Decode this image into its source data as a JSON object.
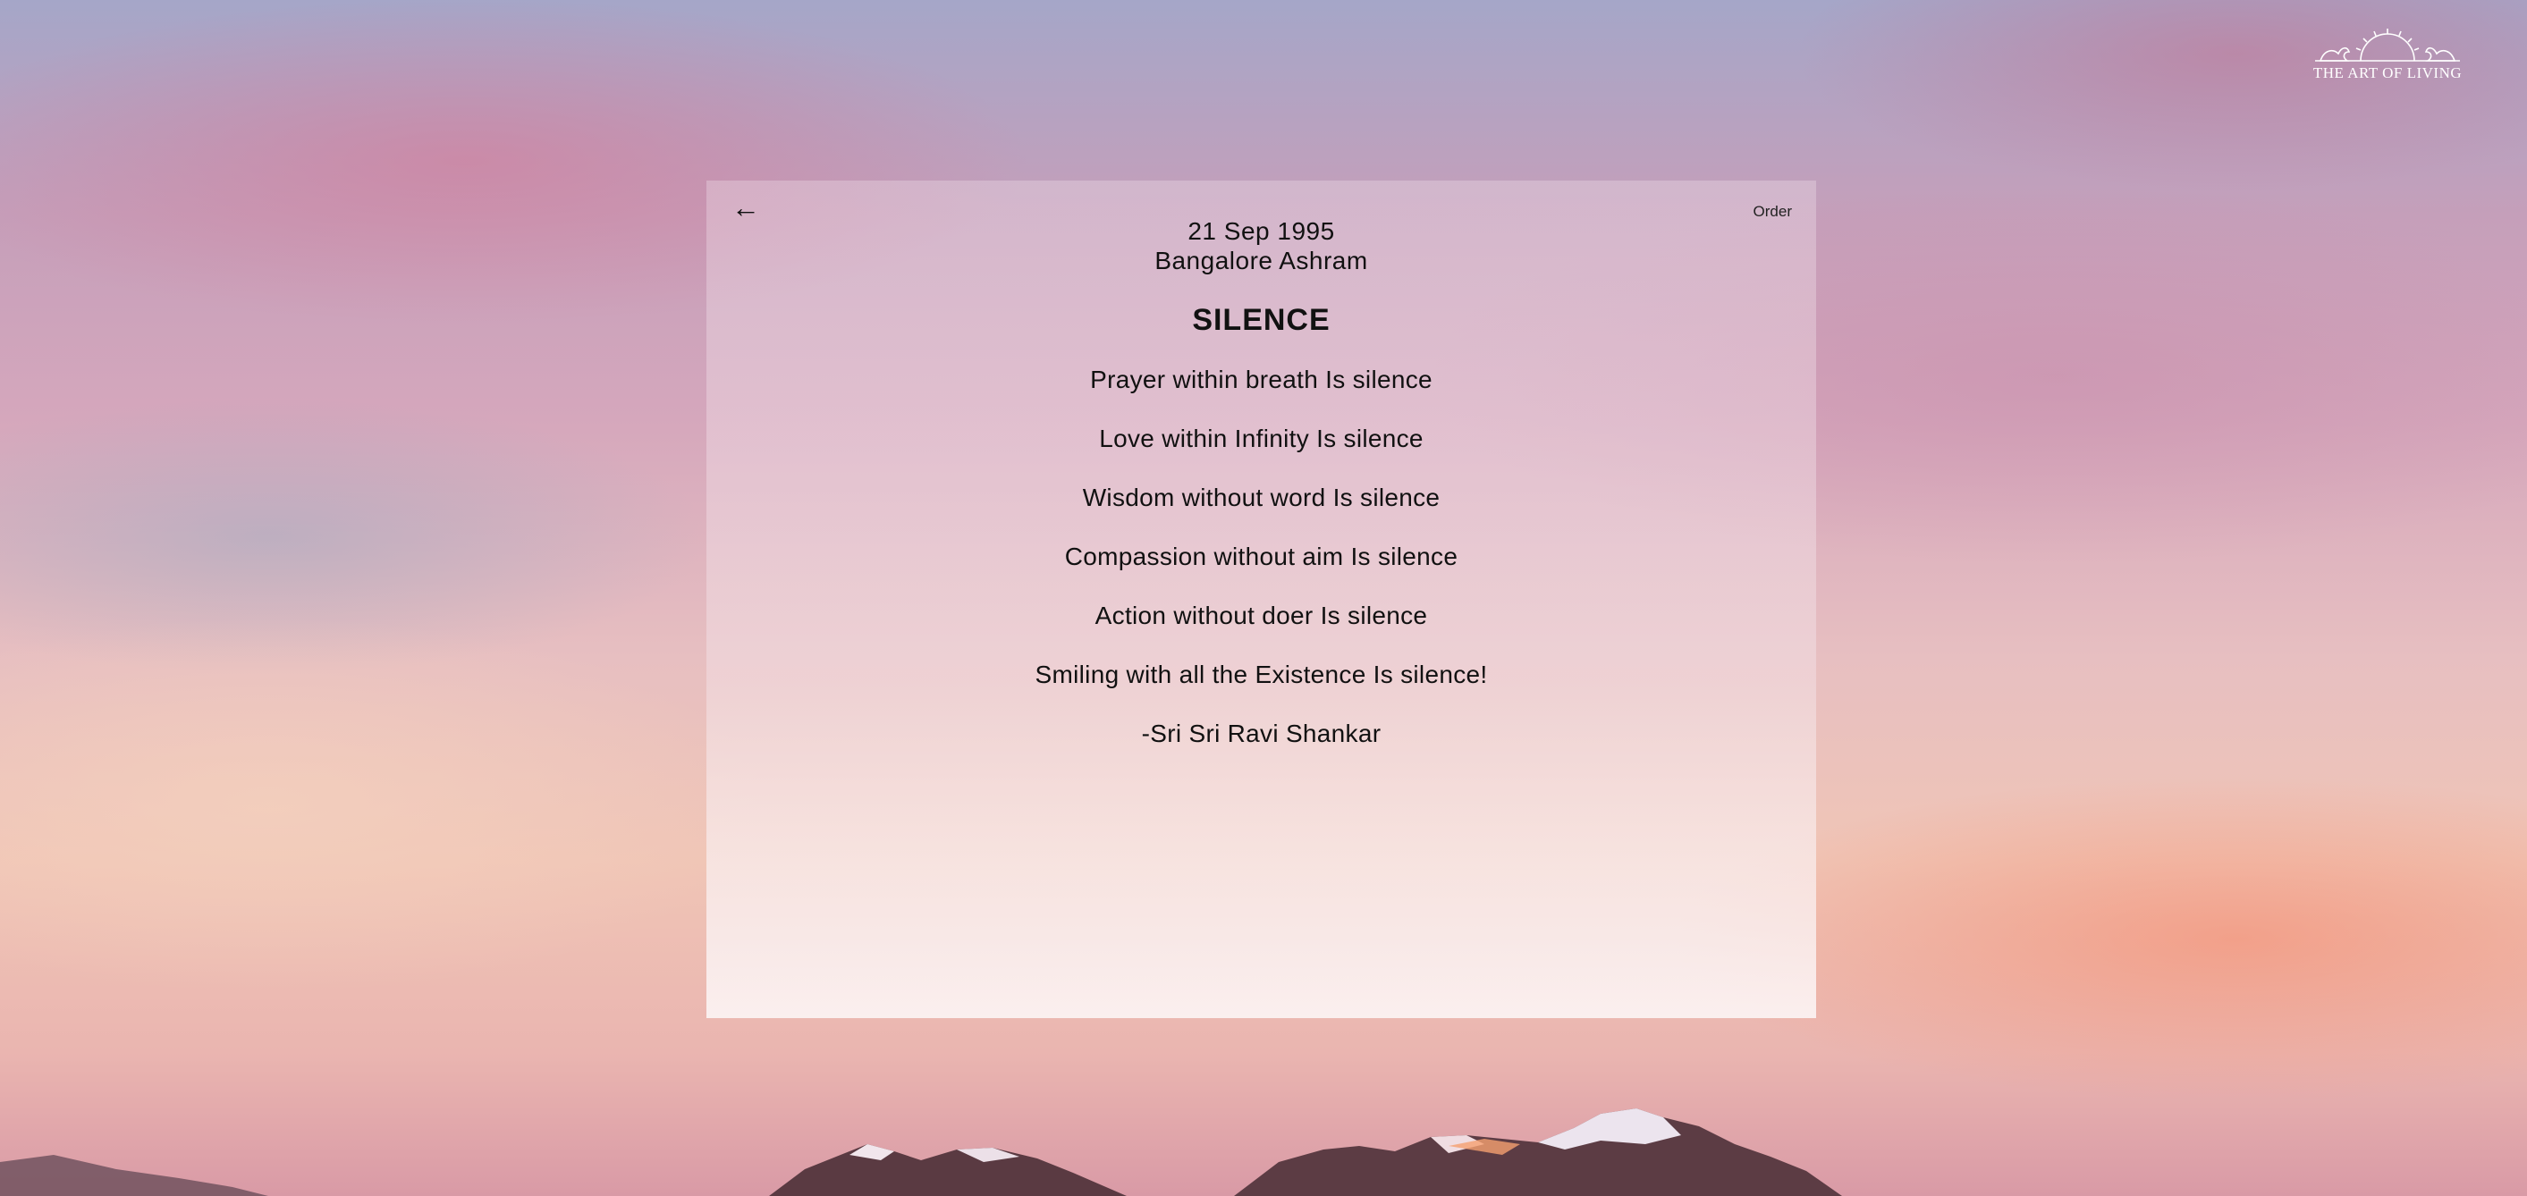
{
  "brand": {
    "logo_text": "THE ART OF LIVING"
  },
  "nav": {
    "back_icon": "←",
    "order_label": "Order"
  },
  "quote": {
    "date": "21 Sep 1995",
    "place": "Bangalore Ashram",
    "title": "SILENCE",
    "lines": [
      "Prayer within breath Is silence",
      "Love within Infinity Is silence",
      "Wisdom without word Is silence",
      "Compassion without aim Is silence",
      "Action without doer Is silence",
      "Smiling with all the Existence Is silence!",
      "-Sri Sri Ravi Shankar"
    ]
  },
  "colors": {
    "text": "#111111",
    "logo": "#ffffff"
  }
}
